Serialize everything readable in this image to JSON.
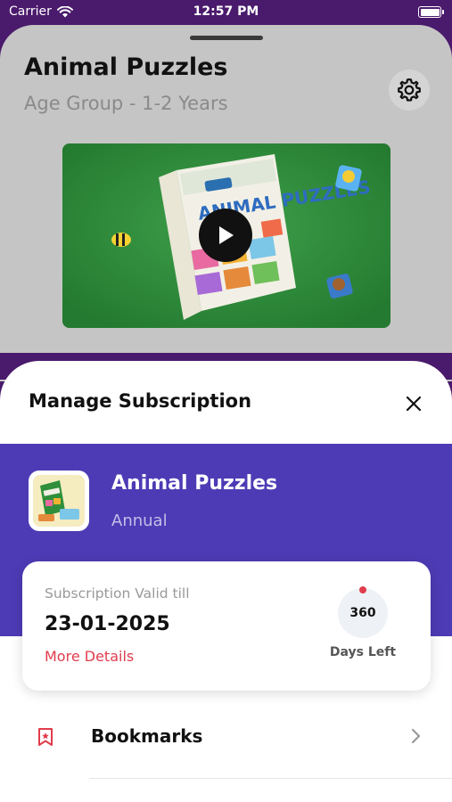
{
  "status_bar": {
    "carrier": "Carrier",
    "time": "12:57 PM"
  },
  "product": {
    "title": "Animal Puzzles",
    "age_group": "Age Group - 1-2 Years",
    "box_label": "ANIMAL PUZZLES",
    "box_side": "ANIMAL PUZZLES"
  },
  "sheet": {
    "title": "Manage Subscription",
    "plan": {
      "name": "Animal Puzzles",
      "period": "Annual"
    },
    "validity": {
      "label": "Subscription Valid till",
      "date": "23-01-2025",
      "details_link": "More Details",
      "days_value": "360",
      "days_label": "Days Left"
    },
    "menu": [
      {
        "label": "Bookmarks",
        "icon": "bookmark-icon"
      }
    ]
  },
  "colors": {
    "header_purple": "#4a1a6c",
    "plan_band": "#4d3bb5",
    "accent_red": "#e03d4d",
    "video_green": "#2f8f3a"
  },
  "icons": [
    "wifi-icon",
    "battery-icon",
    "gear-icon",
    "play-icon",
    "close-icon",
    "bookmark-icon",
    "chevron-right-icon"
  ]
}
